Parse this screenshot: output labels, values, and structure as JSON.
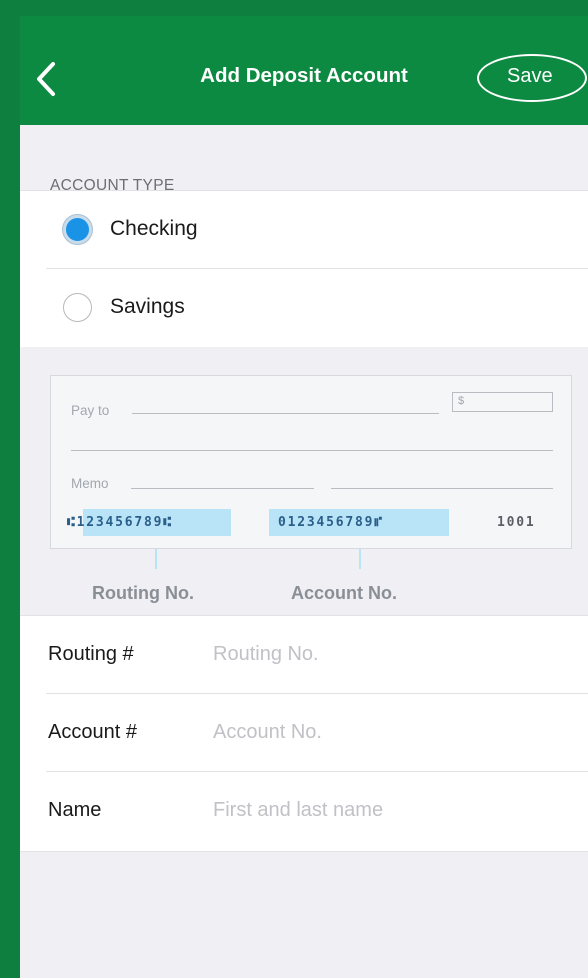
{
  "header": {
    "back_icon": "chevron-left-icon",
    "title": "Add Deposit Account",
    "save_label": "Save"
  },
  "account_type": {
    "section_label": "ACCOUNT TYPE",
    "options": [
      {
        "label": "Checking",
        "selected": true
      },
      {
        "label": "Savings",
        "selected": false
      }
    ]
  },
  "check_illustration": {
    "pay_to_label": "Pay to",
    "dollar_sign": "$",
    "memo_label": "Memo",
    "routing_micr": "⑆123456789⑆",
    "account_micr": "0123456789⑈",
    "check_number_micr": "1001",
    "routing_caption": "Routing No.",
    "account_caption": "Account No."
  },
  "fields": [
    {
      "label": "Routing #",
      "placeholder": "Routing No.",
      "value": ""
    },
    {
      "label": "Account #",
      "placeholder": "Account No.",
      "value": ""
    },
    {
      "label": "Name",
      "placeholder": "First and last name",
      "value": ""
    }
  ],
  "colors": {
    "nav_green": "#0d8a41",
    "radio_selected": "#1a93e6",
    "micr_highlight": "#b9e3f7"
  }
}
